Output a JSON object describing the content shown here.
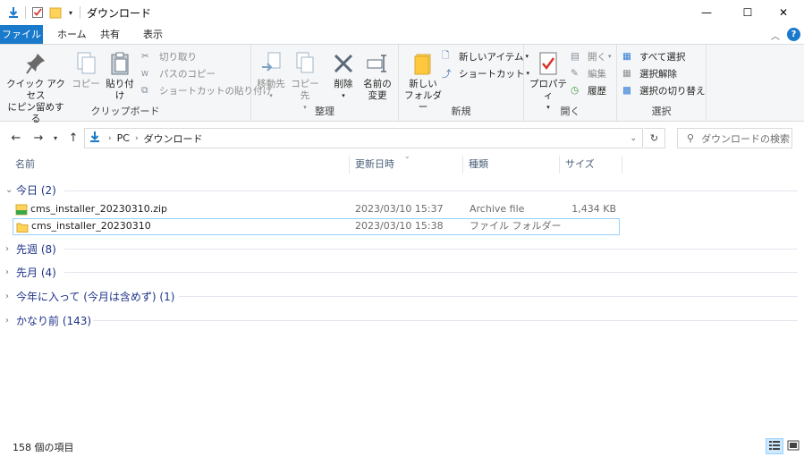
{
  "window": {
    "title": "ダウンロード",
    "minimize_glyph": "—",
    "maximize_glyph": "☐",
    "close_glyph": "✕"
  },
  "menu": {
    "tabs": [
      "ファイル",
      "ホーム",
      "共有",
      "表示"
    ]
  },
  "ribbon": {
    "clipboard": {
      "label": "クリップボード",
      "pin_line1": "クイック アクセス",
      "pin_line2": "にピン留めする",
      "copy": "コピー",
      "paste": "貼り付け",
      "cut": "切り取り",
      "copy_path": "パスのコピー",
      "paste_shortcut": "ショートカットの貼り付け"
    },
    "organize": {
      "label": "整理",
      "move_to": "移動先",
      "copy_to": "コピー先",
      "delete": "削除",
      "rename_line1": "名前の",
      "rename_line2": "変更"
    },
    "new": {
      "label": "新規",
      "new_folder_line1": "新しい",
      "new_folder_line2": "フォルダー",
      "new_item": "新しいアイテム",
      "shortcut": "ショートカット"
    },
    "open": {
      "label": "開く",
      "properties": "プロパティ",
      "open": "開く",
      "edit": "編集",
      "history": "履歴"
    },
    "select": {
      "label": "選択",
      "select_all": "すべて選択",
      "select_none": "選択解除",
      "invert": "選択の切り替え"
    }
  },
  "address": {
    "path": [
      "PC",
      "ダウンロード"
    ],
    "search_placeholder": "ダウンロードの検索"
  },
  "columns": [
    "名前",
    "更新日時",
    "種類",
    "サイズ"
  ],
  "groups": [
    {
      "label": "今日 (2)",
      "expanded": true,
      "files": [
        {
          "name": "cms_installer_20230310.zip",
          "date": "2023/03/10 15:37",
          "type": "Archive file",
          "size": "1,434 KB",
          "icon": "zip-file-icon",
          "selected": false
        },
        {
          "name": "cms_installer_20230310",
          "date": "2023/03/10 15:38",
          "type": "ファイル フォルダー",
          "size": "",
          "icon": "folder-icon",
          "selected": true
        }
      ]
    },
    {
      "label": "先週 (8)",
      "expanded": false
    },
    {
      "label": "先月 (4)",
      "expanded": false
    },
    {
      "label": "今年に入って (今月は含めず) (1)",
      "expanded": false
    },
    {
      "label": "かなり前 (143)",
      "expanded": false
    }
  ],
  "status": {
    "item_count": "158 個の項目"
  },
  "colors": {
    "accent": "#1979ca",
    "group_text": "#1e3287",
    "selection_border": "#99d1ff",
    "ribbon_bg": "#f5f6f7"
  }
}
